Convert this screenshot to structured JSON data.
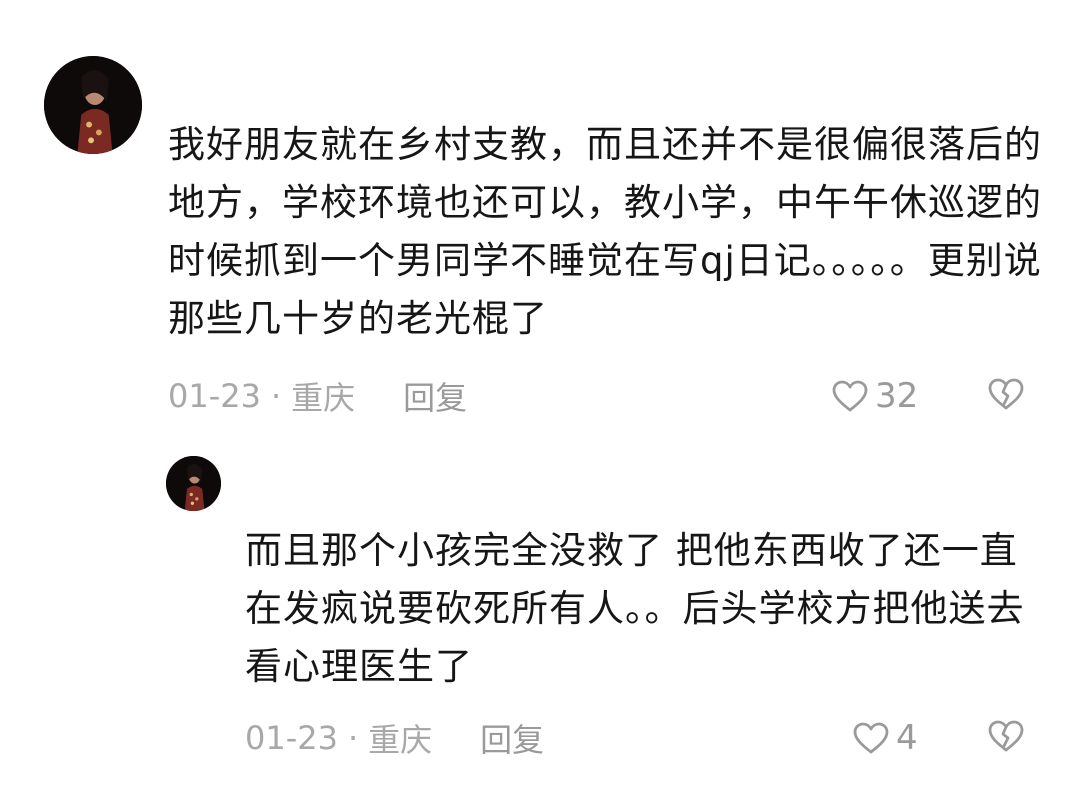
{
  "comments": [
    {
      "text": "我好朋友就在乡村支教，而且还并不是很偏很落后的地方，学校环境也还可以，教小学，中午午休巡逻的时候抓到一个男同学不睡觉在写qj日记。。。。。更别说那些几十岁的老光棍了",
      "date": "01-23",
      "separator": "·",
      "location": "重庆",
      "reply_label": "回复",
      "likes": "32",
      "like_icon": "heart-outline-icon",
      "dislike_icon": "broken-heart-icon"
    },
    {
      "text": "而且那个小孩完全没救了 把他东西收了还一直在发疯说要砍死所有人。。后头学校方把他送去看心理医生了",
      "date": "01-23",
      "separator": "·",
      "location": "重庆",
      "reply_label": "回复",
      "likes": "4",
      "like_icon": "heart-outline-icon",
      "dislike_icon": "broken-heart-icon"
    }
  ],
  "colors": {
    "text": "#161616",
    "meta": "#a8a8a8",
    "icon": "#9a9a9a",
    "background": "#ffffff"
  }
}
